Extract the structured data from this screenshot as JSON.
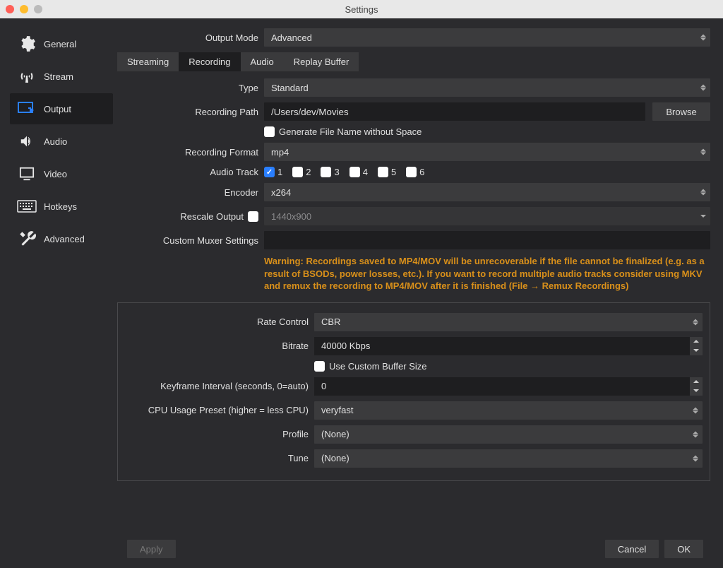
{
  "window": {
    "title": "Settings"
  },
  "sidebar": {
    "items": [
      {
        "label": "General"
      },
      {
        "label": "Stream"
      },
      {
        "label": "Output"
      },
      {
        "label": "Audio"
      },
      {
        "label": "Video"
      },
      {
        "label": "Hotkeys"
      },
      {
        "label": "Advanced"
      }
    ],
    "active": "Output"
  },
  "output_mode": {
    "label": "Output Mode",
    "value": "Advanced"
  },
  "tabs": {
    "items": [
      "Streaming",
      "Recording",
      "Audio",
      "Replay Buffer"
    ],
    "active": "Recording"
  },
  "recording": {
    "type": {
      "label": "Type",
      "value": "Standard"
    },
    "path": {
      "label": "Recording Path",
      "value": "/Users/dev/Movies",
      "browse": "Browse"
    },
    "no_space": {
      "label": "Generate File Name without Space",
      "checked": false
    },
    "format": {
      "label": "Recording Format",
      "value": "mp4"
    },
    "audio_track": {
      "label": "Audio Track",
      "tracks": [
        {
          "n": "1",
          "checked": true
        },
        {
          "n": "2",
          "checked": false
        },
        {
          "n": "3",
          "checked": false
        },
        {
          "n": "4",
          "checked": false
        },
        {
          "n": "5",
          "checked": false
        },
        {
          "n": "6",
          "checked": false
        }
      ]
    },
    "encoder": {
      "label": "Encoder",
      "value": "x264"
    },
    "rescale": {
      "label": "Rescale Output",
      "checked": false,
      "value": "1440x900"
    },
    "muxer": {
      "label": "Custom Muxer Settings",
      "value": ""
    },
    "warning": "Warning: Recordings saved to MP4/MOV will be unrecoverable if the file cannot be finalized (e.g. as a result of BSODs, power losses, etc.). If you want to record multiple audio tracks consider using MKV and remux the recording to MP4/MOV after it is finished (File → Remux Recordings)"
  },
  "encoder_settings": {
    "rate_control": {
      "label": "Rate Control",
      "value": "CBR"
    },
    "bitrate": {
      "label": "Bitrate",
      "value": "40000 Kbps"
    },
    "custom_buffer": {
      "label": "Use Custom Buffer Size",
      "checked": false
    },
    "keyframe": {
      "label": "Keyframe Interval (seconds, 0=auto)",
      "value": "0"
    },
    "cpu_preset": {
      "label": "CPU Usage Preset (higher = less CPU)",
      "value": "veryfast"
    },
    "profile": {
      "label": "Profile",
      "value": "(None)"
    },
    "tune": {
      "label": "Tune",
      "value": "(None)"
    }
  },
  "footer": {
    "apply": "Apply",
    "cancel": "Cancel",
    "ok": "OK"
  }
}
